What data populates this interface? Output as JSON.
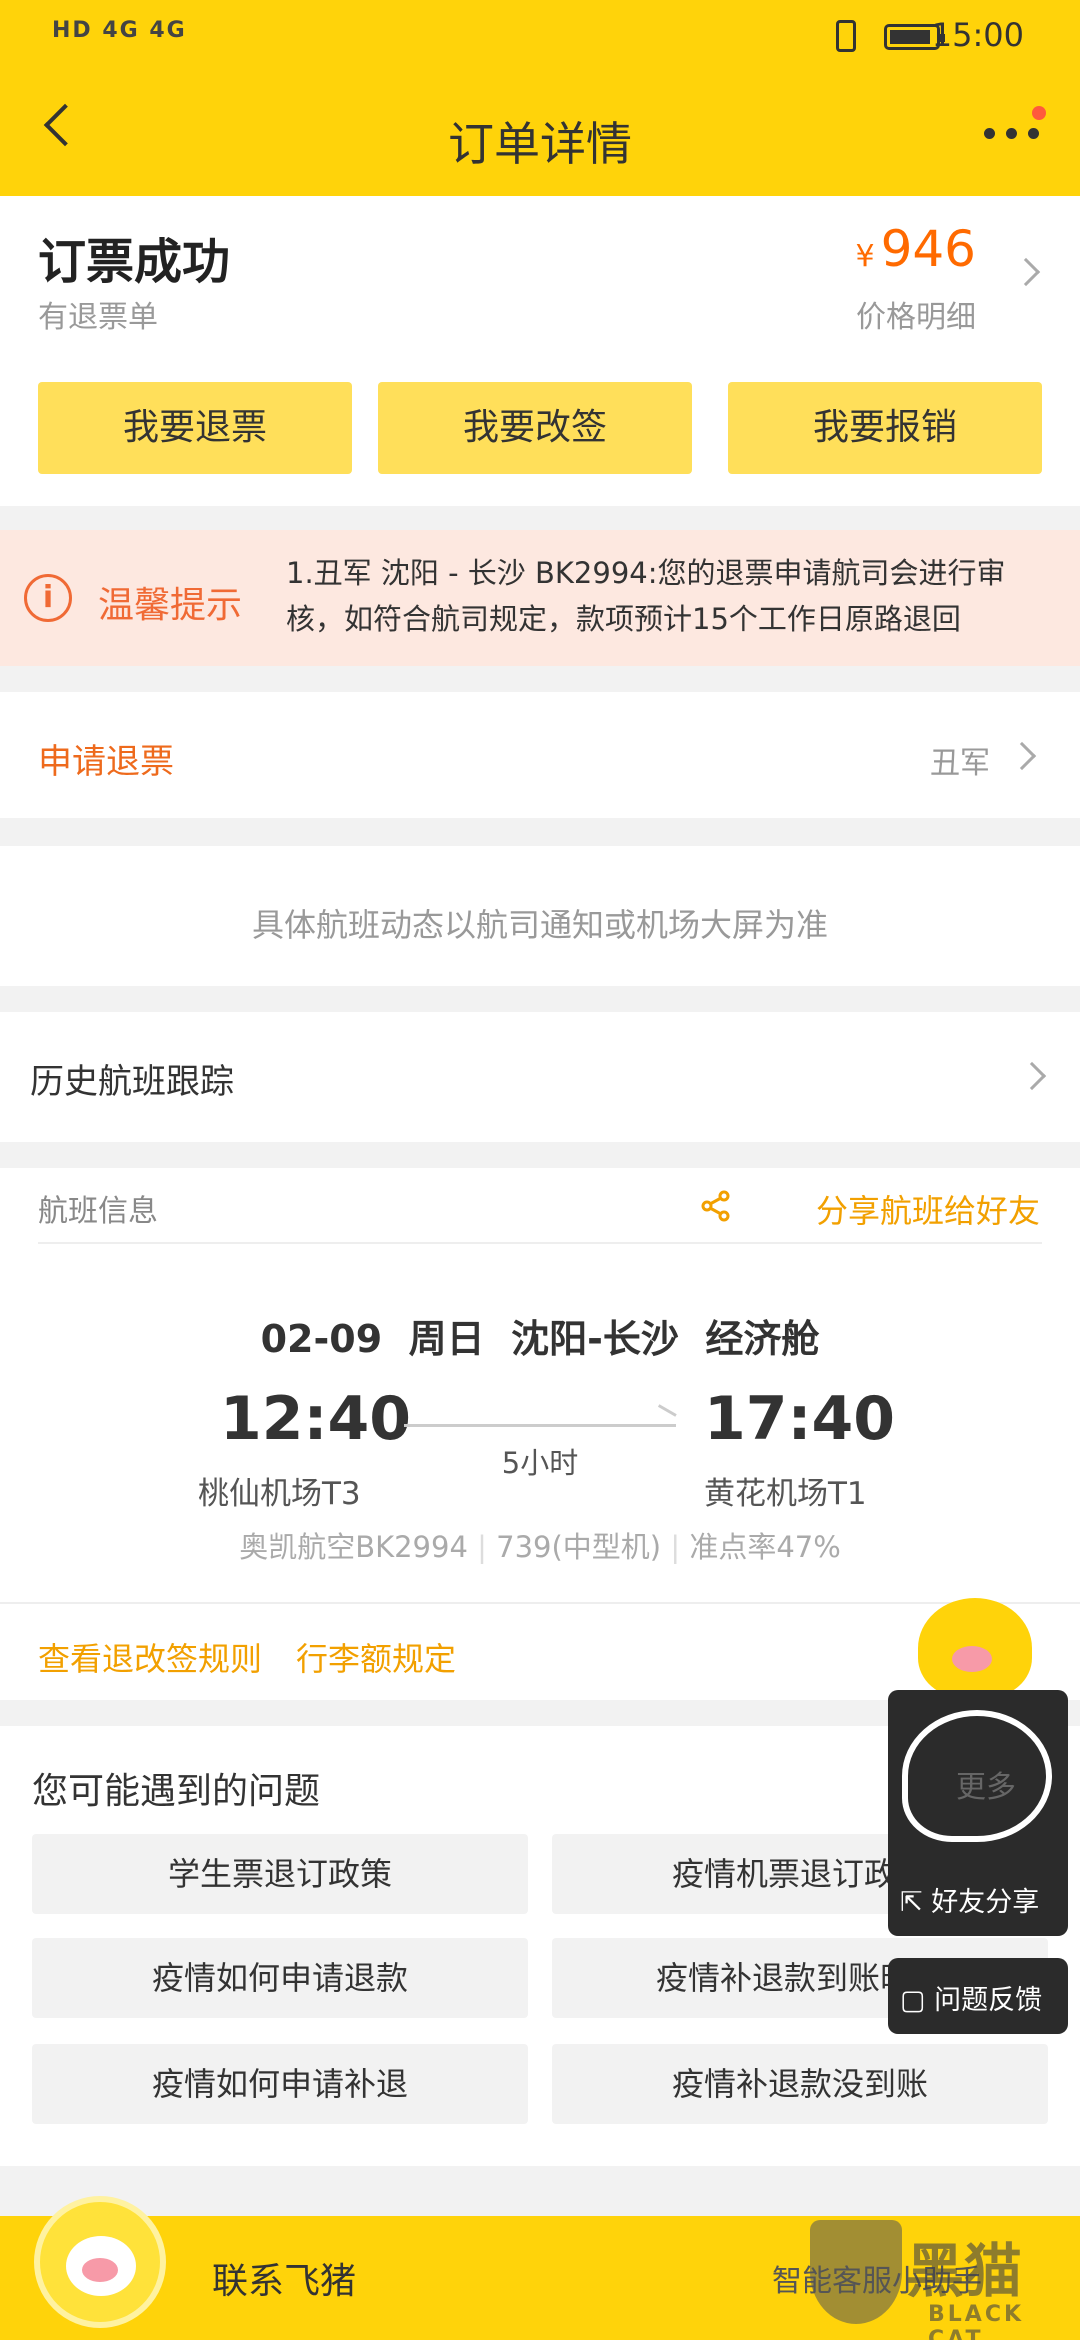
{
  "status_bar": {
    "left": "HD 4G 4G",
    "time": "15:00"
  },
  "header": {
    "title": "订单详情"
  },
  "order": {
    "status": "订票成功",
    "sub_status": "有退票单",
    "currency": "¥",
    "price": "946",
    "price_detail": "价格明细"
  },
  "actions": {
    "refund": "我要退票",
    "change": "我要改签",
    "reimburse": "我要报销"
  },
  "notice": {
    "label": "温馨提示",
    "text": "1.丑军 沈阳 - 长沙 BK2994:您的退票申请航司会进行审核，如符合航司规定，款项预计15个工作日原路退回"
  },
  "refund_request": {
    "label": "申请退票",
    "passenger": "丑军"
  },
  "dynamic_note": "具体航班动态以航司通知或机场大屏为准",
  "history": {
    "label": "历史航班跟踪"
  },
  "flight": {
    "section_title": "航班信息",
    "share": "分享航班给好友",
    "date": "02-09",
    "weekday": "周日",
    "route": "沈阳-长沙",
    "cabin": "经济舱",
    "depart_time": "12:40",
    "arrive_time": "17:40",
    "depart_airport": "桃仙机场T3",
    "arrive_airport": "黄花机场T1",
    "duration": "5小时",
    "airline": "奥凯航空BK2994",
    "aircraft": "739(中型机)",
    "on_time": "准点率47%"
  },
  "links": {
    "rules": "查看退改签规则",
    "luggage": "行李额规定"
  },
  "faq": {
    "title": "您可能遇到的问题",
    "items": [
      "学生票退订政策",
      "疫情机票退订政策",
      "疫情如何申请退款",
      "疫情补退款到账时长",
      "疫情如何申请补退",
      "疫情补退款没到账"
    ]
  },
  "float": {
    "more": "更多",
    "share": "好友分享",
    "feedback": "问题反馈"
  },
  "bottom": {
    "contact": "联系飞猪",
    "assistant": "智能客服小助手"
  },
  "watermark": {
    "cn": "黑猫",
    "en": "BLACK CAT"
  }
}
